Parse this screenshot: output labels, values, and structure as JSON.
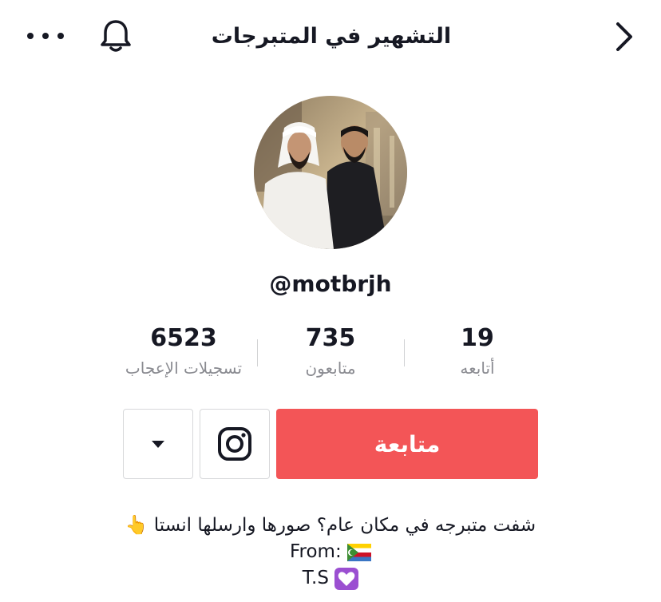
{
  "header": {
    "title": "التشهير في المتبرجات",
    "icons": {
      "more": "more-dots-icon",
      "bell": "bell-icon",
      "back": "chevron-right-icon"
    }
  },
  "profile": {
    "username": "@motbrjh",
    "avatar": "profile-photo"
  },
  "stats": {
    "likes": {
      "value": "6523",
      "label": "تسجيلات الإعجاب"
    },
    "followers": {
      "value": "735",
      "label": "متابعون"
    },
    "following": {
      "value": "19",
      "label": "أتابعه"
    }
  },
  "actions": {
    "follow_label": "متابعة",
    "follow_color": "#f35557",
    "instagram_icon": "instagram-icon",
    "dropdown_icon": "caret-down-icon"
  },
  "bio": {
    "line1": "شفت متبرجه في مكان عام؟ صورها وارسلها انستا",
    "line1_emoji": "👆",
    "line2": "From:",
    "line2_emoji": "comoros-flag",
    "line3": "T.S",
    "line3_emoji": "purple-heart"
  }
}
